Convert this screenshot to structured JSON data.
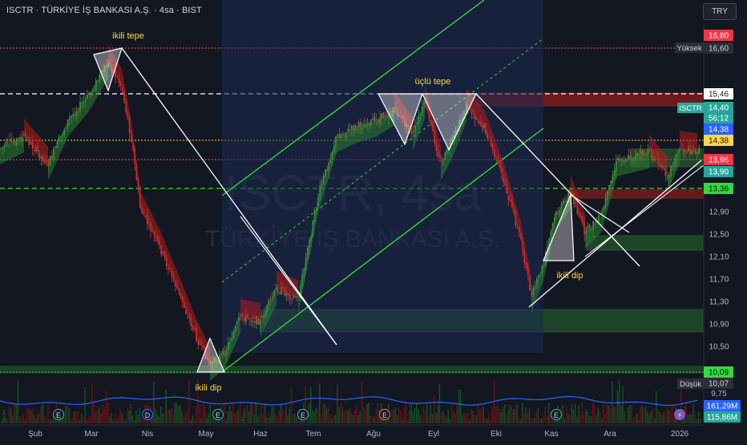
{
  "header": {
    "title": "ISCTR · TÜRKİYE İŞ BANKASI A.Ş. · 4sa · BIST",
    "currency": "TRY"
  },
  "watermark": {
    "line1": "ISCTR, 4sa",
    "line2": "TÜRKİYE İŞ BANKASI A.Ş."
  },
  "colors": {
    "background": "#131722",
    "bull": "#2e7d32",
    "bear": "#b71c1c",
    "channel": "#35d93b",
    "channel_fill": "#1b2a52",
    "trendline": "#ffffff",
    "annotation": "#ffd740",
    "volume_line": "#2962ff"
  },
  "annotations": {
    "top1": "ikili tepe",
    "top2": "üçlü tepe",
    "bottom1": "ikili dip",
    "bottom2": "ikili dip"
  },
  "events": {
    "earnings": "E",
    "dividend": "D"
  },
  "price_labels": {
    "high_tag": "Yüksek",
    "high_value": "16,60",
    "top_red": "16,60",
    "resist": "15,46",
    "symbol": "ISCTR",
    "last": "14,40",
    "countdown": "56:12",
    "blue": "14,38",
    "yellow": "14,38",
    "red2": "13,96",
    "green1": "13,90",
    "green2": "13,36",
    "green_low": "10,09",
    "low_tag": "Düşük",
    "low_value": "10,07",
    "vol_blue": "161,29M",
    "vol_green": "115,86M"
  },
  "chart_data": {
    "type": "candlestick",
    "symbol": "ISCTR",
    "timeframe": "4sa",
    "exchange": "BIST",
    "x_ticks": [
      "Şub",
      "Mar",
      "Nis",
      "May",
      "Haz",
      "Tem",
      "Ağu",
      "Eyl",
      "Eki",
      "Kas",
      "Ara",
      "2026"
    ],
    "y_ticks": [
      "12,90",
      "12,50",
      "12,10",
      "11,70",
      "11,30",
      "10,90",
      "10,50",
      "9,75"
    ],
    "x": [
      "Şub",
      "Mar",
      "Nis",
      "May",
      "Haz",
      "Tem",
      "Ağu",
      "Eyl",
      "Eki",
      "Kas",
      "Ara",
      "2026"
    ],
    "close": [
      13.6,
      15.9,
      11.3,
      10.2,
      11.4,
      14.6,
      15.3,
      14.2,
      11.5,
      12.9,
      14.0,
      14.4
    ],
    "high": 16.6,
    "low": 10.07,
    "last": 14.4,
    "levels": [
      15.46,
      14.38,
      13.96,
      13.9,
      13.36,
      10.09
    ]
  }
}
